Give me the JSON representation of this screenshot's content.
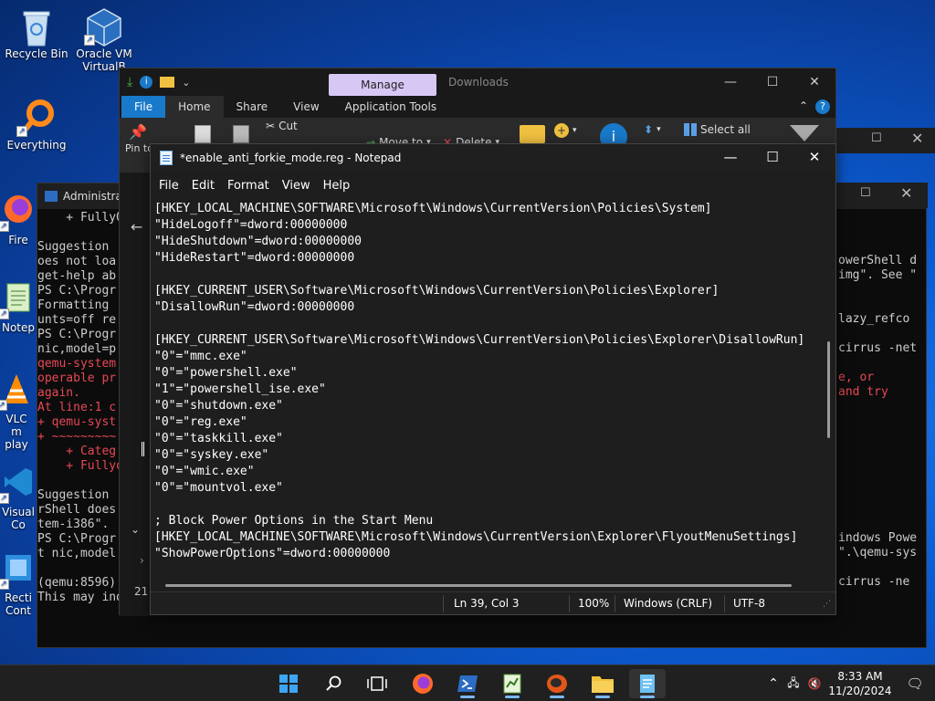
{
  "desktop": {
    "icons": [
      {
        "label": "Recycle Bin",
        "icon": "recycle-bin-icon"
      },
      {
        "label": "Oracle VM VirtualB",
        "icon": "virtualbox-icon"
      },
      {
        "label": "Everything",
        "icon": "everything-search-icon"
      },
      {
        "label": "Fire",
        "icon": "firefox-icon"
      },
      {
        "label": "Notep",
        "icon": "notepad-icon"
      },
      {
        "label": "VLC m play",
        "icon": "vlc-icon"
      },
      {
        "label": "Visual Co",
        "icon": "visual-studio-code-icon"
      },
      {
        "label": "Recti Cont",
        "icon": "shortcut-icon"
      }
    ]
  },
  "powershell": {
    "title": "Administra",
    "lines": [
      "    + FullyQ",
      "",
      "Suggestion ",
      "oes not loa",
      "get-help ab",
      "PS C:\\Progr",
      "Formatting ",
      "unts=off re",
      "PS C:\\Progr",
      "nic,model=p",
      "qemu-system",
      "operable pr",
      "again.",
      "At line:1 c",
      "+ qemu-syst",
      "+ ~~~~~~~~~",
      "    + Categ",
      "    + Fullyq",
      "",
      "Suggestion ",
      "rShell does",
      "tem-i386\". ",
      "PS C:\\Progr",
      "t nic,model",
      "",
      "(qemu:8596): Gtk-WARNING **: ...",
      "This may indicate that pixbuf loaders or the mime database could not be found."
    ],
    "right_lines": [
      "owerShell d",
      "img\". See \"",
      "",
      "",
      "lazy_refco",
      "",
      "cirrus -net",
      "",
      "e, or",
      "and try",
      "",
      "",
      "",
      "",
      "",
      "",
      "",
      "",
      "",
      "indows Powe",
      "\".\\qemu-sys",
      "",
      "cirrus -ne"
    ]
  },
  "explorer": {
    "manage_tab": "Manage",
    "downloads_label": "Downloads",
    "tabs": [
      "File",
      "Home",
      "Share",
      "View",
      "Application Tools"
    ],
    "ribbon": {
      "pin_label": "Pin to ac",
      "cut_label": "Cut",
      "move_to_label": "Move to",
      "delete_label": "Delete",
      "select_all_label": "Select all"
    },
    "left_pane_number": "21"
  },
  "notepad": {
    "title": "*enable_anti_forkie_mode.reg - Notepad",
    "menu": [
      "File",
      "Edit",
      "Format",
      "View",
      "Help"
    ],
    "content": "[HKEY_LOCAL_MACHINE\\SOFTWARE\\Microsoft\\Windows\\CurrentVersion\\Policies\\System]\n\"HideLogoff\"=dword:00000000\n\"HideShutdown\"=dword:00000000\n\"HideRestart\"=dword:00000000\n\n[HKEY_CURRENT_USER\\Software\\Microsoft\\Windows\\CurrentVersion\\Policies\\Explorer]\n\"DisallowRun\"=dword:00000000\n\n[HKEY_CURRENT_USER\\Software\\Microsoft\\Windows\\CurrentVersion\\Policies\\Explorer\\DisallowRun]\n\"0\"=\"mmc.exe\"\n\"0\"=\"powershell.exe\"\n\"1\"=\"powershell_ise.exe\"\n\"0\"=\"shutdown.exe\"\n\"0\"=\"reg.exe\"\n\"0\"=\"taskkill.exe\"\n\"0\"=\"syskey.exe\"\n\"0\"=\"wmic.exe\"\n\"0\"=\"mountvol.exe\"\n\n; Block Power Options in the Start Menu\n[HKEY_LOCAL_MACHINE\\SOFTWARE\\Microsoft\\Windows\\CurrentVersion\\Explorer\\FlyoutMenuSettings]\n\"ShowPowerOptions\"=dword:00000000",
    "status": {
      "position": "Ln 39, Col 3",
      "zoom": "100%",
      "line_ending": "Windows (CRLF)",
      "encoding": "UTF-8"
    }
  },
  "taskbar": {
    "time": "8:33 AM",
    "date": "11/20/2024",
    "apps": [
      "start-icon",
      "search-icon",
      "task-view-icon",
      "firefox-icon",
      "powershell-icon",
      "spreadsheet-icon",
      "qemu-icon",
      "file-explorer-icon",
      "notepad-icon"
    ]
  },
  "colors": {
    "accent": "#1979ca",
    "manage_tab": "#d7c7f5",
    "error_text": "#e74856"
  }
}
